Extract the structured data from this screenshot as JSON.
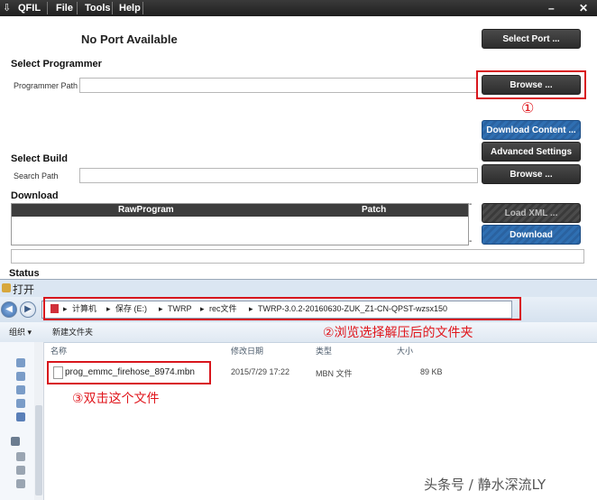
{
  "app": {
    "title": "QFIL",
    "logo_icon": "arrow-down-icon",
    "menu": [
      "File",
      "Tools",
      "Help"
    ],
    "window_controls": {
      "minimize": "–",
      "close": "✕"
    }
  },
  "status": {
    "port": "No Port Available"
  },
  "buttons": {
    "select_port": "Select Port ...",
    "browse_programmer": "Browse ...",
    "download_content": "Download Content ...",
    "advanced_settings": "Advanced Settings",
    "browse_build": "Browse ...",
    "load_xml": "Load XML ...",
    "download": "Download"
  },
  "programmer": {
    "section": "Select Programmer",
    "label": "Programmer Path",
    "value": ""
  },
  "build": {
    "section": "Select Build",
    "label": "Search Path",
    "value": ""
  },
  "download_section": {
    "section": "Download",
    "columns": [
      "RawProgram",
      "Patch"
    ],
    "dash1": "-",
    "dash2": "-"
  },
  "status_section": {
    "label": "Status"
  },
  "open_dialog": {
    "title": "打开",
    "breadcrumb": [
      "计算机",
      "保存 (E:)",
      "TWRP",
      "rec文件",
      "TWRP-3.0.2-20160630-ZUK_Z1-CN-QPST-wzsx150"
    ],
    "organize": "组织 ▾",
    "new_folder": "新建文件夹",
    "columns": {
      "name": "名称",
      "modified": "修改日期",
      "type": "类型",
      "size": "大小"
    },
    "files": [
      {
        "name": "prog_emmc_firehose_8974.mbn",
        "modified": "2015/7/29 17:22",
        "type": "MBN 文件",
        "size": "89 KB"
      }
    ]
  },
  "annotations": {
    "step1": "①",
    "step2": "②浏览选择解压后的文件夹",
    "step3": "③双击这个文件"
  },
  "watermark": "头条号 / 静水深流LY",
  "colors": {
    "annotation_red": "#d8161d",
    "download_blue": "#2f6fb2",
    "titlebar": "#2a2a2a"
  }
}
